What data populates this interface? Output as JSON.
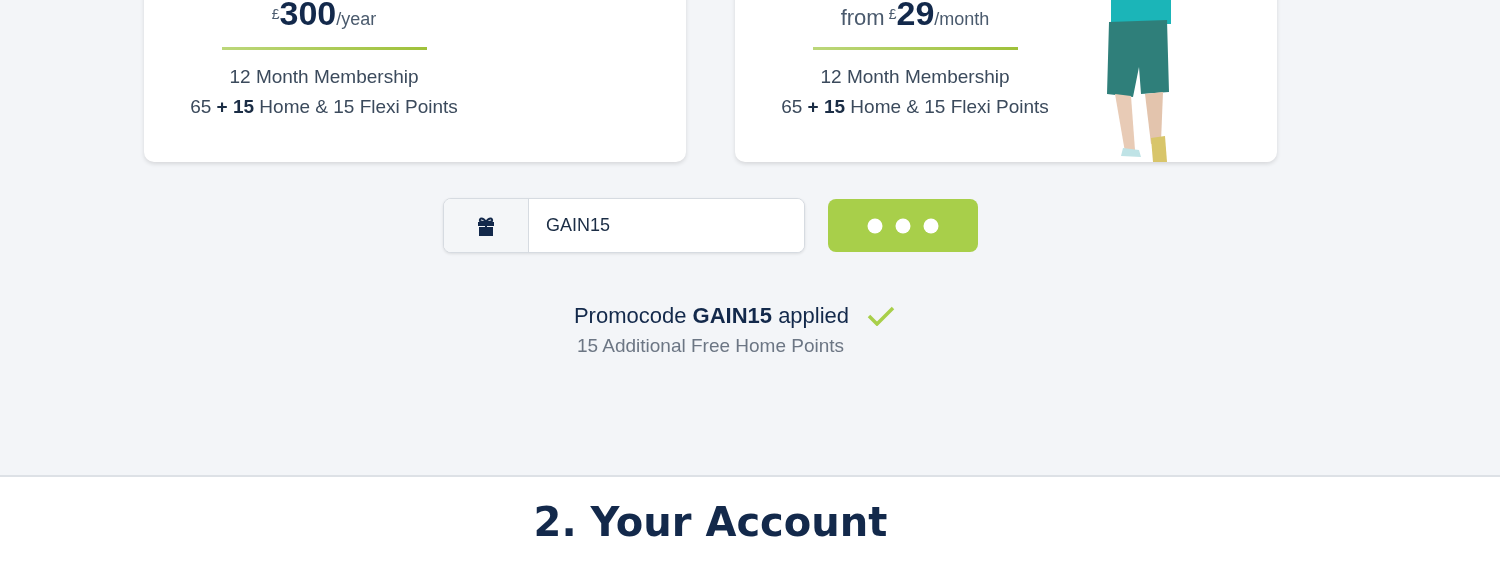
{
  "plans": [
    {
      "currency": "£",
      "amount": "300",
      "period": "/year",
      "details": [
        "12 Month Membership",
        "65 **+ 15** Home & 15 Flexi Points"
      ]
    },
    {
      "prefix": "from",
      "currency": "£",
      "amount": "29",
      "period": "/month",
      "details": [
        "12 Month Membership",
        "65 **+ 15** Home & 15 Flexi Points"
      ]
    }
  ],
  "promo": {
    "value": "GAIN15",
    "loading": true
  },
  "promo_message": {
    "title": "Promocode **GAIN15** applied",
    "applied": true,
    "subtitle": "15 Additional Free Home Points"
  },
  "next_section": {
    "heading": "2. Your Account"
  }
}
